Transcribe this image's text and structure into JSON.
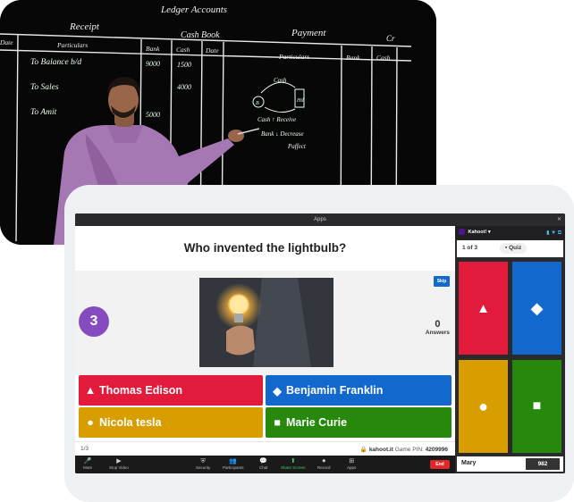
{
  "video": {
    "board_heading": "Ledger Accounts",
    "receipt_label": "Receipt",
    "payment_label": "Payment",
    "cash_book_label": "Cash Book",
    "cr_label": "Cr",
    "col_date": "Date",
    "col_particulars": "Particulars",
    "col_bank": "Bank",
    "col_cash": "Cash",
    "rows": [
      {
        "particulars": "To Balance b/d",
        "bank": "9000",
        "cash": "1500"
      },
      {
        "particulars": "To Sales",
        "bank": "",
        "cash": "4000"
      },
      {
        "particulars": "To Amit",
        "bank": "5000",
        "cash": ""
      }
    ],
    "diagram": {
      "top": "Cash",
      "left": "B",
      "right": "Hil",
      "note1": "Cash ↑ Receive",
      "note2": "Bank ↓ Decrease",
      "note3": "Paffect"
    }
  },
  "app": {
    "window_title": "Apps",
    "question": "Who invented the lightbulb?",
    "timer": "3",
    "answers_count": "0",
    "answers_label": "Answers",
    "skip_label": "Skip",
    "answers": [
      {
        "label": "Thomas Edison",
        "shape": "▲"
      },
      {
        "label": "Benjamin Franklin",
        "shape": "◆"
      },
      {
        "label": "Nicola tesla",
        "shape": "●"
      },
      {
        "label": "Marie Curie",
        "shape": "■"
      }
    ],
    "progress": "1/3",
    "site": "kahoot.it",
    "game_pin_label": "Game PIN:",
    "game_pin": "4209996",
    "toolbar": [
      {
        "label": "Mute",
        "icon": "🎤"
      },
      {
        "label": "Stop Video",
        "icon": "▶"
      },
      {
        "label": "Security",
        "icon": "⛨"
      },
      {
        "label": "Participants",
        "icon": "👥"
      },
      {
        "label": "Chat",
        "icon": "💬"
      },
      {
        "label": "Share Screen",
        "icon": "⬆"
      },
      {
        "label": "Record",
        "icon": "⏺"
      },
      {
        "label": "Apps",
        "icon": "⊞"
      }
    ],
    "end_label": "End"
  },
  "panel": {
    "app_name": "Kahoot!",
    "question_index": "1 of 3",
    "quiz_label": "Quiz",
    "tiles": [
      "▲",
      "◆",
      "●",
      "■"
    ],
    "player_name": "Mary",
    "player_score": "982"
  },
  "colors": {
    "red": "#e21b3c",
    "blue": "#1368ce",
    "yellow": "#d89e00",
    "green": "#26890c",
    "purple": "#864cbf"
  }
}
